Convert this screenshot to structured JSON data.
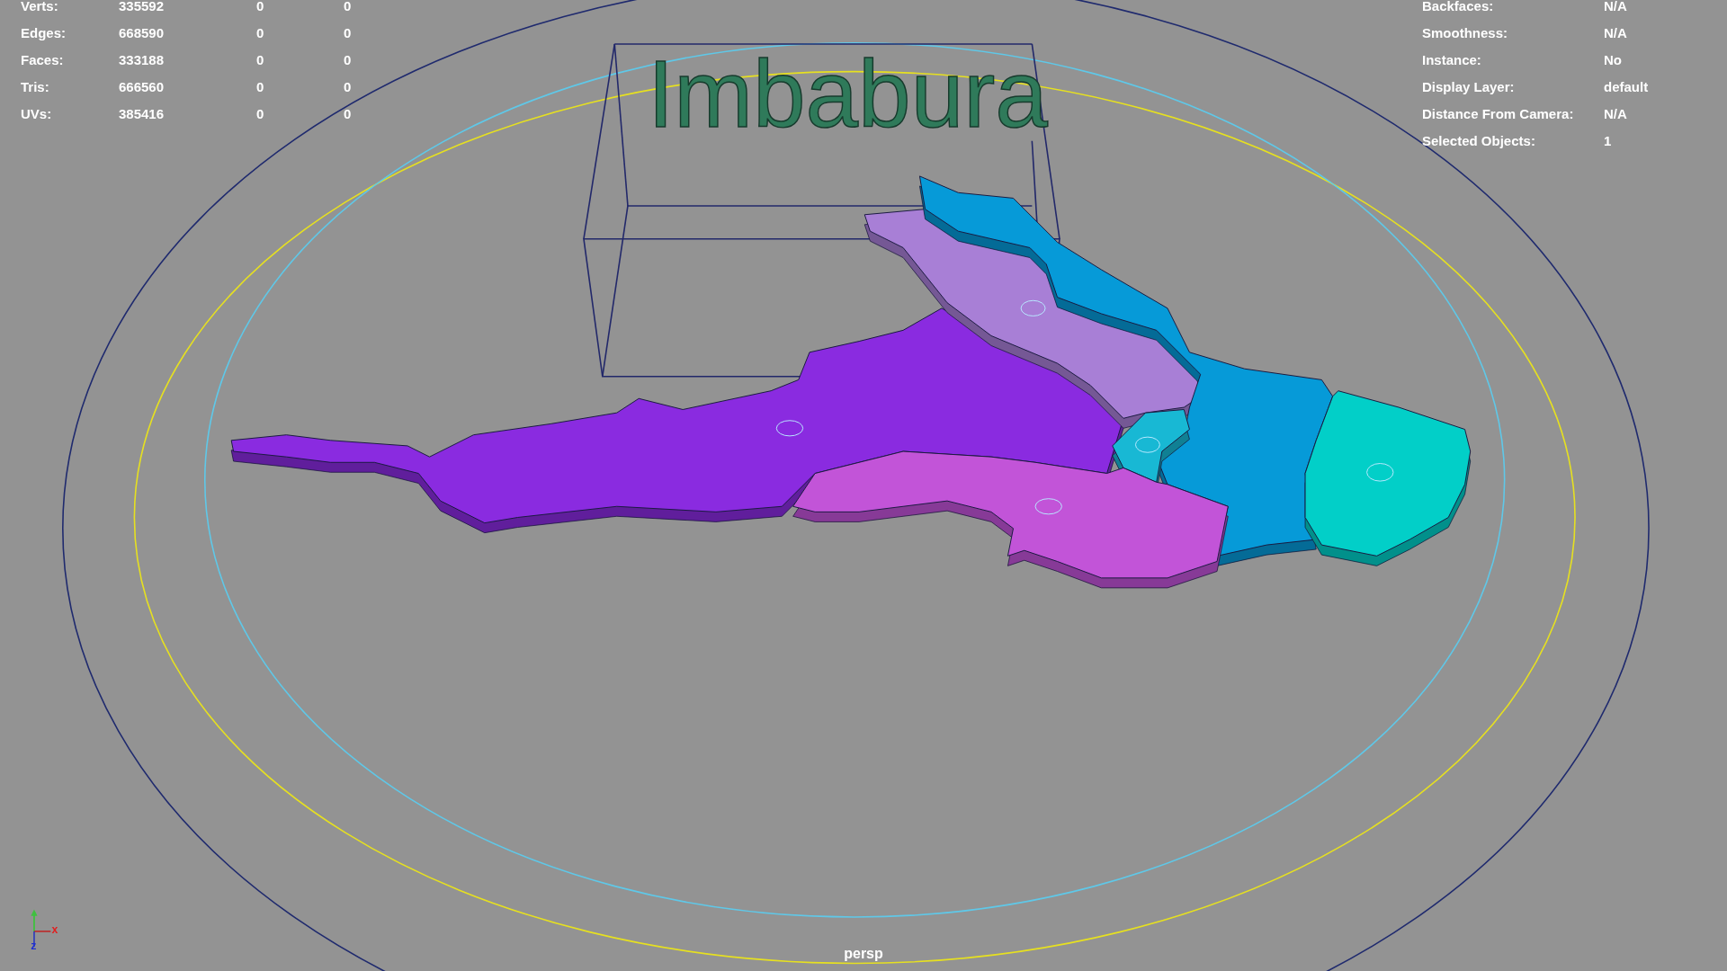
{
  "hud_left": {
    "rows": [
      {
        "label": "Verts:",
        "value": "335592",
        "column_3": "0",
        "column_4": "0"
      },
      {
        "label": "Edges:",
        "value": "668590",
        "column_3": "0",
        "column_4": "0"
      },
      {
        "label": "Faces:",
        "value": "333188",
        "column_3": "0",
        "column_4": "0"
      },
      {
        "label": "Tris:",
        "value": "666560",
        "column_3": "0",
        "column_4": "0"
      },
      {
        "label": "UVs:",
        "value": "385416",
        "column_3": "0",
        "column_4": "0"
      }
    ]
  },
  "hud_right": {
    "rows": [
      {
        "label": "Backfaces:",
        "value": "N/A"
      },
      {
        "label": "Smoothness:",
        "value": "N/A"
      },
      {
        "label": "Instance:",
        "value": "No"
      },
      {
        "label": "Display Layer:",
        "value": "default"
      },
      {
        "label": "Distance From Camera:",
        "value": "N/A"
      },
      {
        "label": "Selected Objects:",
        "value": "1"
      }
    ]
  },
  "scene_title": "Imbabura",
  "regions": [
    {
      "color": "#8a2be0"
    },
    {
      "color": "#a87fd6"
    },
    {
      "color": "#069ad8"
    },
    {
      "color": "#18b8d4"
    },
    {
      "color": "#c254d8"
    },
    {
      "color": "#02cfc8"
    }
  ],
  "axis_labels": [
    "x",
    "z"
  ],
  "camera": "persp"
}
